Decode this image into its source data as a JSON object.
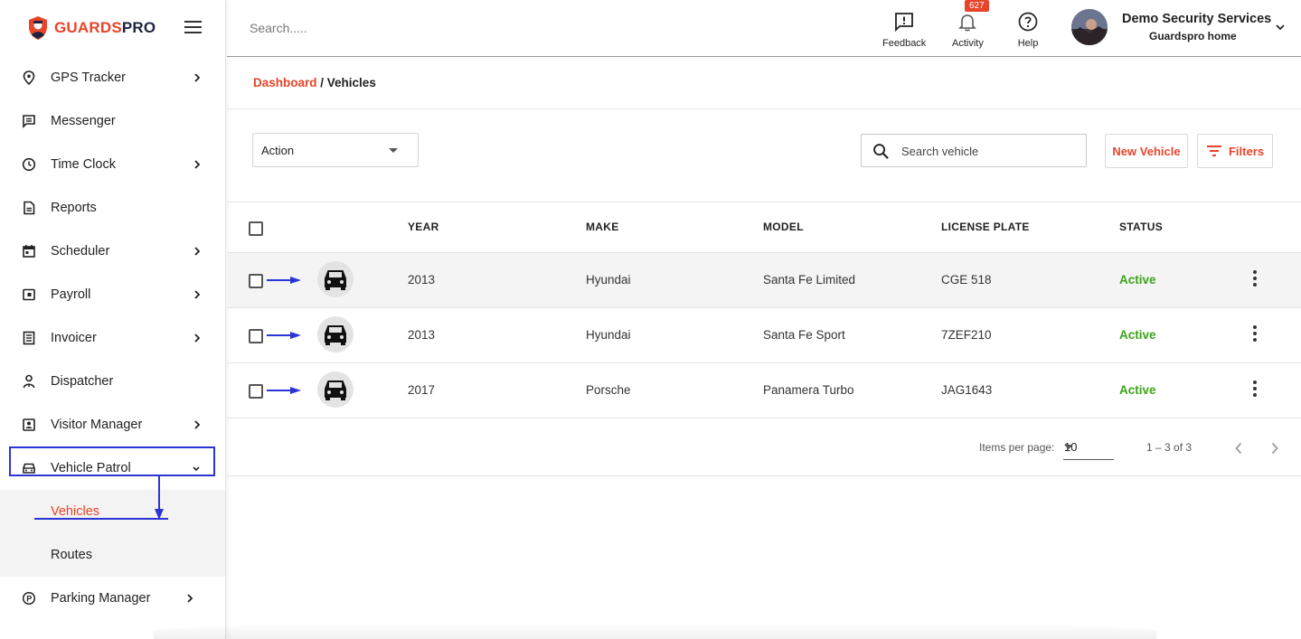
{
  "brand": {
    "name_part1": "GUARDS",
    "name_part2": "PRO",
    "accent_color": "#e8442a",
    "dark_color": "#1d2440"
  },
  "sidebar": {
    "items": [
      {
        "label": "GPS Tracker",
        "icon": "location-pin-icon",
        "expandable": true
      },
      {
        "label": "Messenger",
        "icon": "message-icon",
        "expandable": false
      },
      {
        "label": "Time Clock",
        "icon": "clock-icon",
        "expandable": true
      },
      {
        "label": "Reports",
        "icon": "document-icon",
        "expandable": false
      },
      {
        "label": "Scheduler",
        "icon": "calendar-icon",
        "expandable": true
      },
      {
        "label": "Payroll",
        "icon": "wallet-icon",
        "expandable": true
      },
      {
        "label": "Invoicer",
        "icon": "list-icon",
        "expandable": true
      },
      {
        "label": "Dispatcher",
        "icon": "dispatcher-icon",
        "expandable": false
      },
      {
        "label": "Visitor Manager",
        "icon": "id-badge-icon",
        "expandable": true
      },
      {
        "label": "Vehicle Patrol",
        "icon": "car-icon",
        "expandable": true,
        "expanded": true
      },
      {
        "label": "Parking Manager",
        "icon": "parking-icon",
        "expandable": true
      }
    ],
    "vehicle_patrol_sub": [
      {
        "label": "Vehicles",
        "current": true
      },
      {
        "label": "Routes",
        "current": false
      }
    ]
  },
  "header": {
    "search_placeholder": "Search.....",
    "feedback_label": "Feedback",
    "activity_label": "Activity",
    "activity_count": "627",
    "help_label": "Help",
    "user_name": "Demo Security Services",
    "user_sub": "Guardspro home"
  },
  "breadcrumb": {
    "home": "Dashboard",
    "separator": " / ",
    "current": "Vehicles"
  },
  "toolbar": {
    "action_label": "Action",
    "search_placeholder": "Search vehicle",
    "new_label": "New Vehicle",
    "filters_label": "Filters"
  },
  "table": {
    "columns": [
      "YEAR",
      "MAKE",
      "MODEL",
      "LICENSE PLATE",
      "STATUS"
    ],
    "rows": [
      {
        "year": "2013",
        "make": "Hyundai",
        "model": "Santa Fe Limited",
        "plate": "CGE 518",
        "status": "Active"
      },
      {
        "year": "2013",
        "make": "Hyundai",
        "model": "Santa Fe Sport",
        "plate": "7ZEF210",
        "status": "Active"
      },
      {
        "year": "2017",
        "make": "Porsche",
        "model": "Panamera Turbo",
        "plate": "JAG1643",
        "status": "Active"
      }
    ],
    "status_color": "#3aa317"
  },
  "paginator": {
    "items_label": "Items per page:",
    "items_value": "10",
    "range": "1 – 3 of 3"
  },
  "annotation_color": "#2b35d6"
}
